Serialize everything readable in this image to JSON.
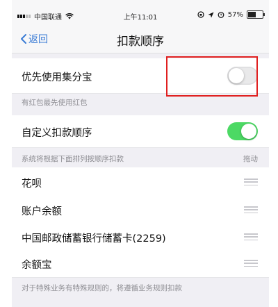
{
  "status_bar": {
    "carrier": "中国联通",
    "time": "上午11:01",
    "battery": "57%",
    "battery_level": 0.57
  },
  "nav": {
    "back_label": "返回",
    "title": "扣款顺序"
  },
  "priority": {
    "label": "优先使用集分宝",
    "toggle_on": false,
    "caption": "有红包最先使用红包"
  },
  "custom": {
    "label": "自定义扣款顺序",
    "toggle_on": true,
    "caption": "系统将根据下面排列按顺序扣款",
    "drag_label": "拖动"
  },
  "methods": [
    {
      "label": "花呗"
    },
    {
      "label": "账户余额"
    },
    {
      "label": "中国邮政储蓄银行储蓄卡(2259)"
    },
    {
      "label": "余额宝"
    }
  ],
  "footer_note": "对于特殊业务有特殊规则的，将遵循业务规则扣款",
  "colors": {
    "accent": "#3a7bd5",
    "toggle_on": "#4cd964",
    "highlight": "#e02020"
  }
}
